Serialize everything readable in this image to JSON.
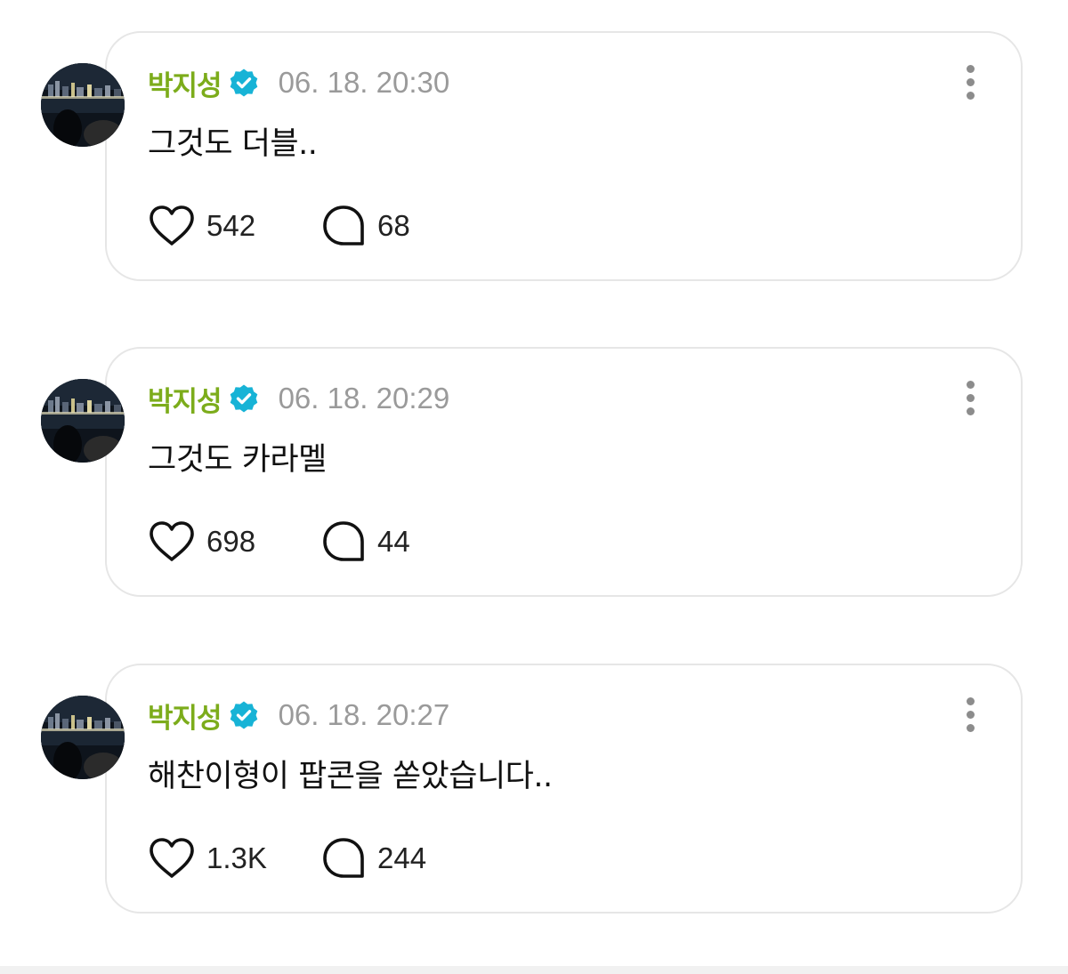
{
  "theme": {
    "author_color": "#7cac1b",
    "verified_color": "#17b3d6",
    "timestamp_color": "#9a9a9a",
    "card_border": "#e6e6e6"
  },
  "posts": [
    {
      "author": "박지성",
      "verified_icon": "verified-badge-icon",
      "timestamp": "06. 18. 20:30",
      "text": "그것도 더블..",
      "likes": "542",
      "comments": "68"
    },
    {
      "author": "박지성",
      "verified_icon": "verified-badge-icon",
      "timestamp": "06. 18. 20:29",
      "text": "그것도 카라멜",
      "likes": "698",
      "comments": "44"
    },
    {
      "author": "박지성",
      "verified_icon": "verified-badge-icon",
      "timestamp": "06. 18. 20:27",
      "text": "해찬이형이 팝콘을 쏟았습니다..",
      "likes": "1.3K",
      "comments": "244"
    }
  ],
  "icons": {
    "like": "heart-icon",
    "comment": "comment-bubble-icon",
    "more": "more-vertical-icon"
  }
}
